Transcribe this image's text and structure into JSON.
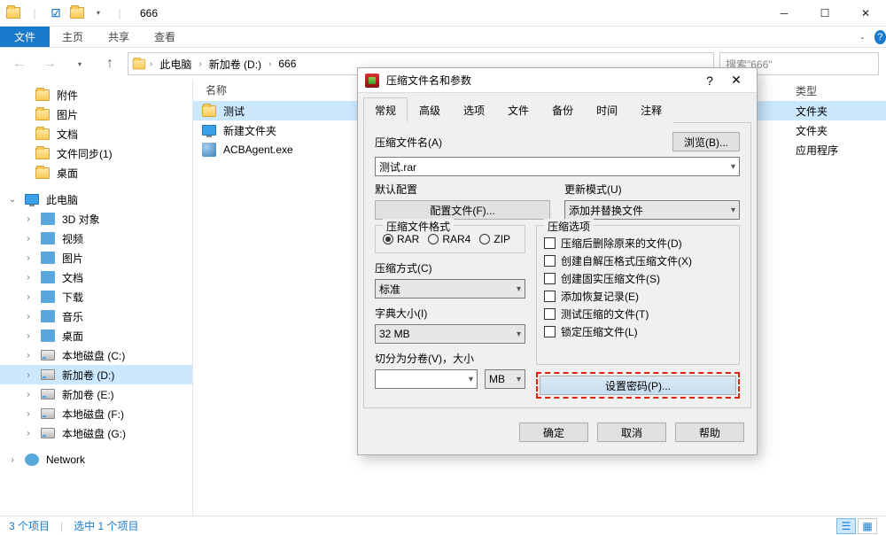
{
  "titlebar": {
    "title": "666"
  },
  "ribbon": {
    "file": "文件",
    "tabs": [
      "主页",
      "共享",
      "查看"
    ]
  },
  "address": {
    "segs": [
      "此电脑",
      "新加卷 (D:)",
      "666"
    ],
    "search_placeholder": "搜索\"666\""
  },
  "quick_access": {
    "items": [
      "附件",
      "图片",
      "文档",
      "文件同步(1)",
      "桌面"
    ]
  },
  "this_pc": {
    "label": "此电脑",
    "items": [
      {
        "label": "3D 对象",
        "k": "generic"
      },
      {
        "label": "视频",
        "k": "generic"
      },
      {
        "label": "图片",
        "k": "generic"
      },
      {
        "label": "文档",
        "k": "generic"
      },
      {
        "label": "下载",
        "k": "generic"
      },
      {
        "label": "音乐",
        "k": "generic"
      },
      {
        "label": "桌面",
        "k": "generic"
      },
      {
        "label": "本地磁盘 (C:)",
        "k": "drive"
      },
      {
        "label": "新加卷 (D:)",
        "k": "drive",
        "selected": true
      },
      {
        "label": "新加卷 (E:)",
        "k": "drive"
      },
      {
        "label": "本地磁盘 (F:)",
        "k": "drive"
      },
      {
        "label": "本地磁盘 (G:)",
        "k": "drive"
      }
    ]
  },
  "network_label": "Network",
  "columns": {
    "name": "名称",
    "type": "类型"
  },
  "files": [
    {
      "name": "测试",
      "type": "文件夹",
      "icon": "folder",
      "selected": true
    },
    {
      "name": "新建文件夹",
      "type": "文件夹",
      "icon": "pc"
    },
    {
      "name": "ACBAgent.exe",
      "type": "应用程序",
      "icon": "exe"
    }
  ],
  "status": {
    "count": "3 个项目",
    "sel": "选中 1 个项目"
  },
  "dialog": {
    "title": "压缩文件名和参数",
    "tabs": [
      "常规",
      "高级",
      "选项",
      "文件",
      "备份",
      "时间",
      "注释"
    ],
    "archive_name_label": "压缩文件名(A)",
    "browse": "浏览(B)...",
    "archive_name_value": "测试.rar",
    "default_profile_label": "默认配置",
    "profiles_btn": "配置文件(F)...",
    "update_mode_label": "更新模式(U)",
    "update_mode_value": "添加并替换文件",
    "format_label": "压缩文件格式",
    "formats": [
      "RAR",
      "RAR4",
      "ZIP"
    ],
    "method_label": "压缩方式(C)",
    "method_value": "标准",
    "dict_label": "字典大小(I)",
    "dict_value": "32 MB",
    "split_label": "切分为分卷(V)，大小",
    "split_unit": "MB",
    "options_label": "压缩选项",
    "options": [
      "压缩后删除原来的文件(D)",
      "创建自解压格式压缩文件(X)",
      "创建固实压缩文件(S)",
      "添加恢复记录(E)",
      "测试压缩的文件(T)",
      "锁定压缩文件(L)"
    ],
    "set_password": "设置密码(P)...",
    "ok": "确定",
    "cancel": "取消",
    "help": "帮助"
  }
}
